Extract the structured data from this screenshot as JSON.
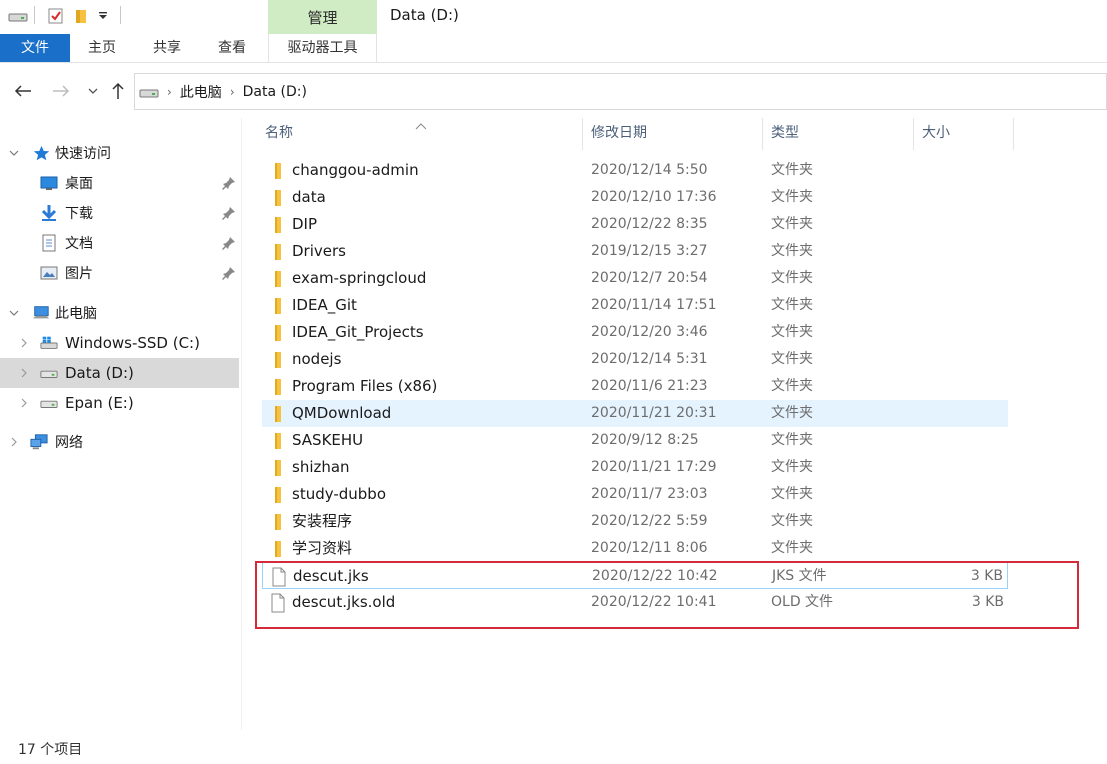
{
  "window": {
    "title": "Data (D:)"
  },
  "ribbon": {
    "manage_tab": "管理",
    "tabs": [
      {
        "label": "文件"
      },
      {
        "label": "主页"
      },
      {
        "label": "共享"
      },
      {
        "label": "查看"
      },
      {
        "label": "驱动器工具"
      }
    ]
  },
  "address": {
    "crumbs": [
      "此电脑",
      "Data (D:)"
    ]
  },
  "navpane": {
    "quick_access": "快速访问",
    "pinned": [
      "桌面",
      "下载",
      "文档",
      "图片"
    ],
    "this_pc": "此电脑",
    "drives": [
      "Windows-SSD (C:)",
      "Data (D:)",
      "Epan (E:)"
    ],
    "network": "网络"
  },
  "columns": {
    "name": "名称",
    "date": "修改日期",
    "type": "类型",
    "size": "大小"
  },
  "files": [
    {
      "name": "changgou-admin",
      "date": "2020/12/14 5:50",
      "type": "文件夹",
      "size": ""
    },
    {
      "name": "data",
      "date": "2020/12/10 17:36",
      "type": "文件夹",
      "size": ""
    },
    {
      "name": "DIP",
      "date": "2020/12/22 8:35",
      "type": "文件夹",
      "size": ""
    },
    {
      "name": "Drivers",
      "date": "2019/12/15 3:27",
      "type": "文件夹",
      "size": ""
    },
    {
      "name": "exam-springcloud",
      "date": "2020/12/7 20:54",
      "type": "文件夹",
      "size": ""
    },
    {
      "name": "IDEA_Git",
      "date": "2020/11/14 17:51",
      "type": "文件夹",
      "size": ""
    },
    {
      "name": "IDEA_Git_Projects",
      "date": "2020/12/20 3:46",
      "type": "文件夹",
      "size": ""
    },
    {
      "name": "nodejs",
      "date": "2020/12/14 5:31",
      "type": "文件夹",
      "size": ""
    },
    {
      "name": "Program Files (x86)",
      "date": "2020/11/6 21:23",
      "type": "文件夹",
      "size": ""
    },
    {
      "name": "QMDownload",
      "date": "2020/11/21 20:31",
      "type": "文件夹",
      "size": ""
    },
    {
      "name": "SASKEHU",
      "date": "2020/9/12 8:25",
      "type": "文件夹",
      "size": ""
    },
    {
      "name": "shizhan",
      "date": "2020/11/21 17:29",
      "type": "文件夹",
      "size": ""
    },
    {
      "name": "study-dubbo",
      "date": "2020/11/7 23:03",
      "type": "文件夹",
      "size": ""
    },
    {
      "name": "安装程序",
      "date": "2020/12/22 5:59",
      "type": "文件夹",
      "size": ""
    },
    {
      "name": "学习资料",
      "date": "2020/12/11 8:06",
      "type": "文件夹",
      "size": ""
    },
    {
      "name": "descut.jks",
      "date": "2020/12/22 10:42",
      "type": "JKS 文件",
      "size": "3 KB"
    },
    {
      "name": "descut.jks.old",
      "date": "2020/12/22 10:41",
      "type": "OLD 文件",
      "size": "3 KB"
    }
  ],
  "status": {
    "count": "17 个项目"
  },
  "colors": {
    "accent": "#1a6fc9",
    "manage_tab": "#cfecc4",
    "selection": "#d9d9d9",
    "hover": "#e5f3ff",
    "highlight_box": "#d42a3a",
    "folder": "#f5c242"
  }
}
